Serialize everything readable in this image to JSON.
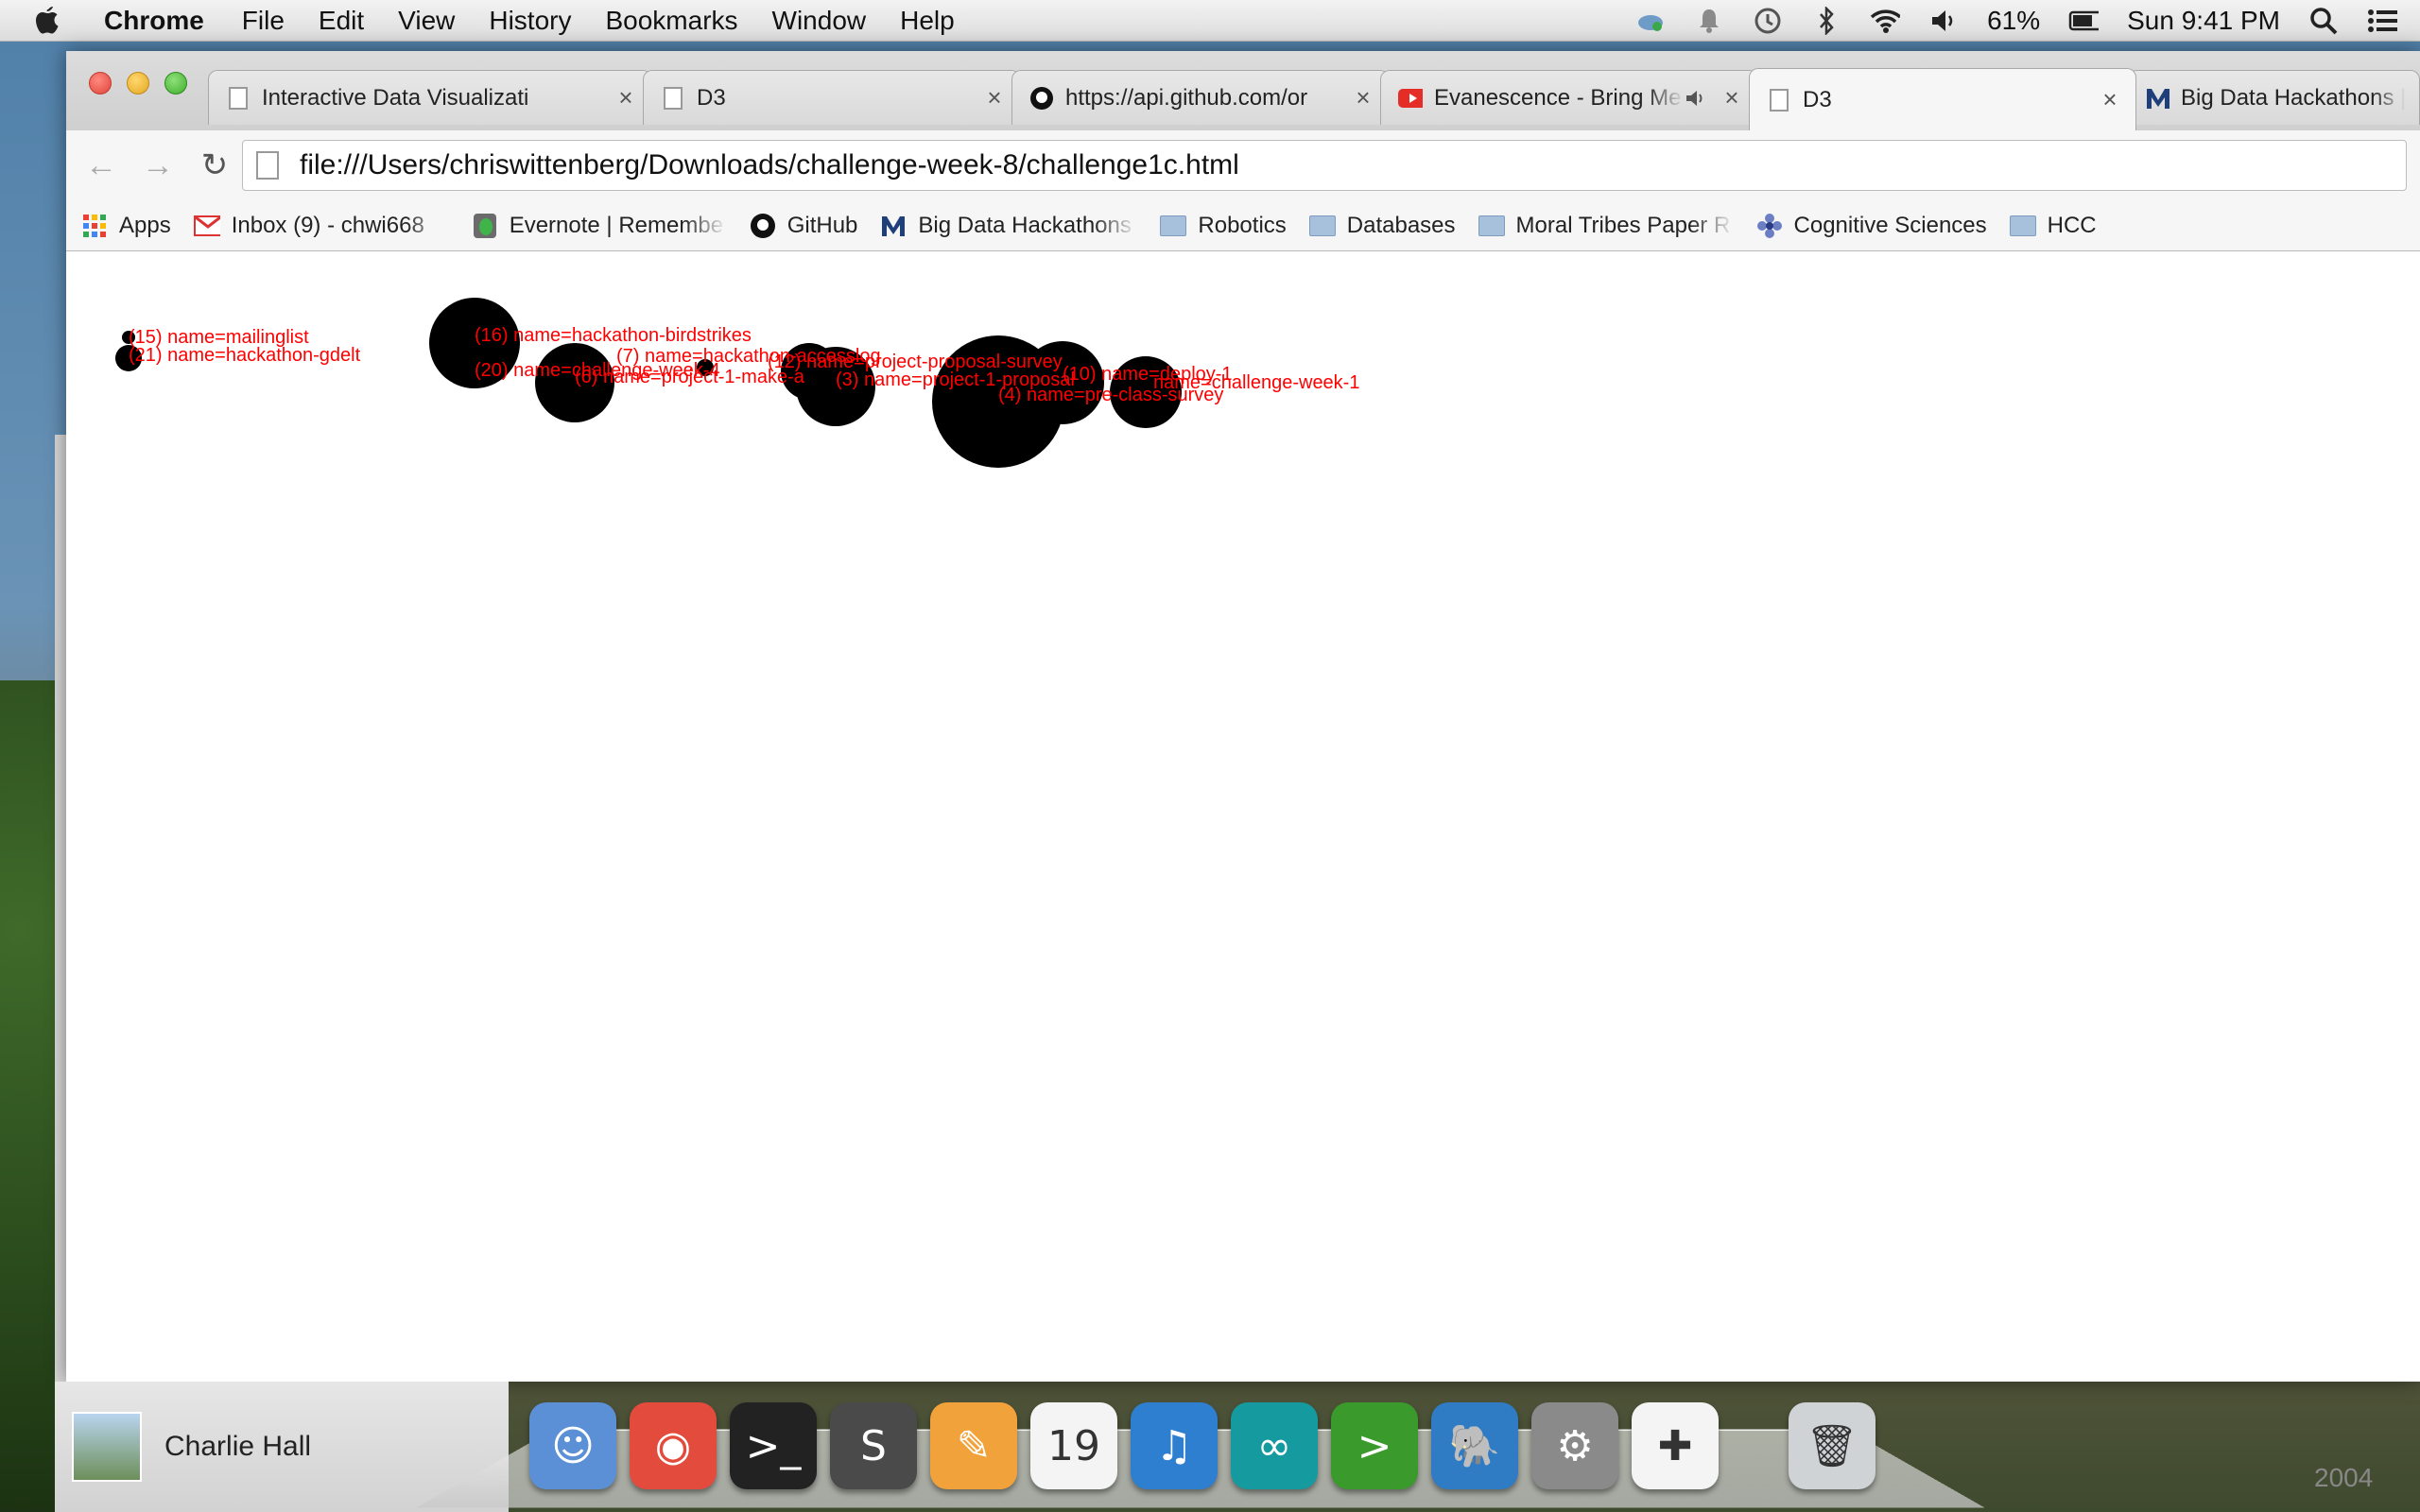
{
  "menubar": {
    "app_name": "Chrome",
    "items": [
      "File",
      "Edit",
      "View",
      "History",
      "Bookmarks",
      "Window",
      "Help"
    ],
    "battery": "61%",
    "clock": "Sun 9:41 PM"
  },
  "tabs": [
    {
      "title": "Interactive Data Visualizati",
      "favicon": "page-icon"
    },
    {
      "title": "D3",
      "favicon": "page-icon"
    },
    {
      "title": "https://api.github.com/or",
      "favicon": "github-icon"
    },
    {
      "title": "Evanescence - Bring Me",
      "favicon": "youtube-icon",
      "audio": true
    },
    {
      "title": "D3",
      "favicon": "page-icon",
      "active": true
    },
    {
      "title": "Big Data Hackathons | Univ",
      "favicon": "m-logo-icon"
    }
  ],
  "tab_close_glyph": "×",
  "toolbar": {
    "url": "file:///Users/chriswittenberg/Downloads/challenge-week-8/challenge1c.html"
  },
  "bookmarks": [
    {
      "label": "Apps",
      "icon": "apps-grid-icon"
    },
    {
      "label": "Inbox (9) - chwi668",
      "icon": "gmail-icon"
    },
    {
      "label": "Evernote | Remembe",
      "icon": "evernote-icon"
    },
    {
      "label": "GitHub",
      "icon": "github-icon"
    },
    {
      "label": "Big Data Hackathons",
      "icon": "m-logo-icon"
    },
    {
      "label": "Robotics",
      "icon": "folder-icon"
    },
    {
      "label": "Databases",
      "icon": "folder-icon"
    },
    {
      "label": "Moral Tribes Paper R",
      "icon": "folder-icon"
    },
    {
      "label": "Cognitive Sciences",
      "icon": "flower-icon"
    },
    {
      "label": "HCC",
      "icon": "folder-icon"
    }
  ],
  "viz": {
    "label_color": "#ff0000",
    "circle_color": "#000000",
    "nodes": [
      {
        "label": "(15) name=mailinglist"
      },
      {
        "label": "(21) name=hackathon-gdelt"
      },
      {
        "label": "(16) name=hackathon-birdstrikes"
      },
      {
        "label": "(20) name=challenge-week-4"
      },
      {
        "label": "(6) name=project-1-make-a"
      },
      {
        "label": "(7) name=hackathon-accesslog"
      },
      {
        "label": "(12) name=project-proposal-survey"
      },
      {
        "label": "(3) name=project-1-proposal"
      },
      {
        "label": "(4) name=pre-class-survey"
      },
      {
        "label": "(10) name=deploy-1"
      },
      {
        "label": "name=challenge-week-1"
      }
    ]
  },
  "dock": {
    "contact_name": "Charlie Hall",
    "year": "2004",
    "apps": [
      {
        "name": "finder-icon",
        "glyph": "☺",
        "color": "#5b8fd6"
      },
      {
        "name": "chrome-icon",
        "glyph": "◉",
        "color": "#e34b3c"
      },
      {
        "name": "terminal-icon",
        "glyph": ">_",
        "color": "#222222"
      },
      {
        "name": "sublime-text-icon",
        "glyph": "S",
        "color": "#4a4a4a"
      },
      {
        "name": "pages-icon",
        "glyph": "✎",
        "color": "#f2a23a"
      },
      {
        "name": "calendar-icon",
        "glyph": "19",
        "color": "#f4f4f4"
      },
      {
        "name": "itunes-icon",
        "glyph": "♫",
        "color": "#2e7fd0"
      },
      {
        "name": "arduino-icon",
        "glyph": "∞",
        "color": "#159aa0"
      },
      {
        "name": "shell-icon",
        "glyph": ">",
        "color": "#3b9a2c"
      },
      {
        "name": "elephant-icon",
        "glyph": "🐘",
        "color": "#2f7cc4"
      },
      {
        "name": "system-preferences-icon",
        "glyph": "⚙",
        "color": "#8a8a8a"
      },
      {
        "name": "tableau-icon",
        "glyph": "✚",
        "color": "#f4f4f4"
      },
      {
        "name": "trash-icon",
        "glyph": "🗑",
        "color": "#cfd3d6"
      }
    ]
  }
}
